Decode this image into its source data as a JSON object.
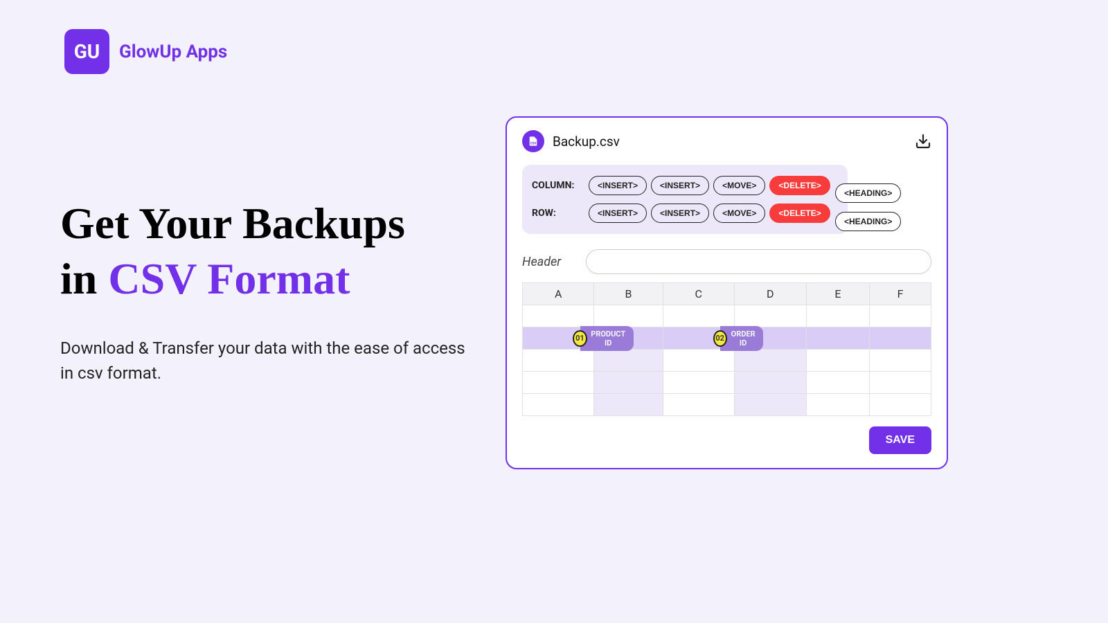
{
  "brand": {
    "logo_initials": "GU",
    "name": "GlowUp Apps"
  },
  "hero": {
    "title_line1": "Get Your Backups",
    "title_prefix": "in ",
    "title_highlight": "CSV Format",
    "subtitle": "Download & Transfer your data with the ease of access in csv format."
  },
  "panel": {
    "filename": "Backup.csv",
    "controls": {
      "column_label": "COLUMN:",
      "row_label": "ROW:",
      "buttons": {
        "insert": "<INSERT>",
        "move": "<MOVE>",
        "delete": "<DELETE>",
        "heading": "<HEADING>"
      }
    },
    "header_label": "Header",
    "header_value": "",
    "columns": [
      "A",
      "B",
      "C",
      "D",
      "E",
      "F"
    ],
    "tags": [
      {
        "num": "01",
        "label": "PRODUCT ID"
      },
      {
        "num": "02",
        "label": "ORDER ID"
      }
    ],
    "save_label": "SAVE"
  }
}
